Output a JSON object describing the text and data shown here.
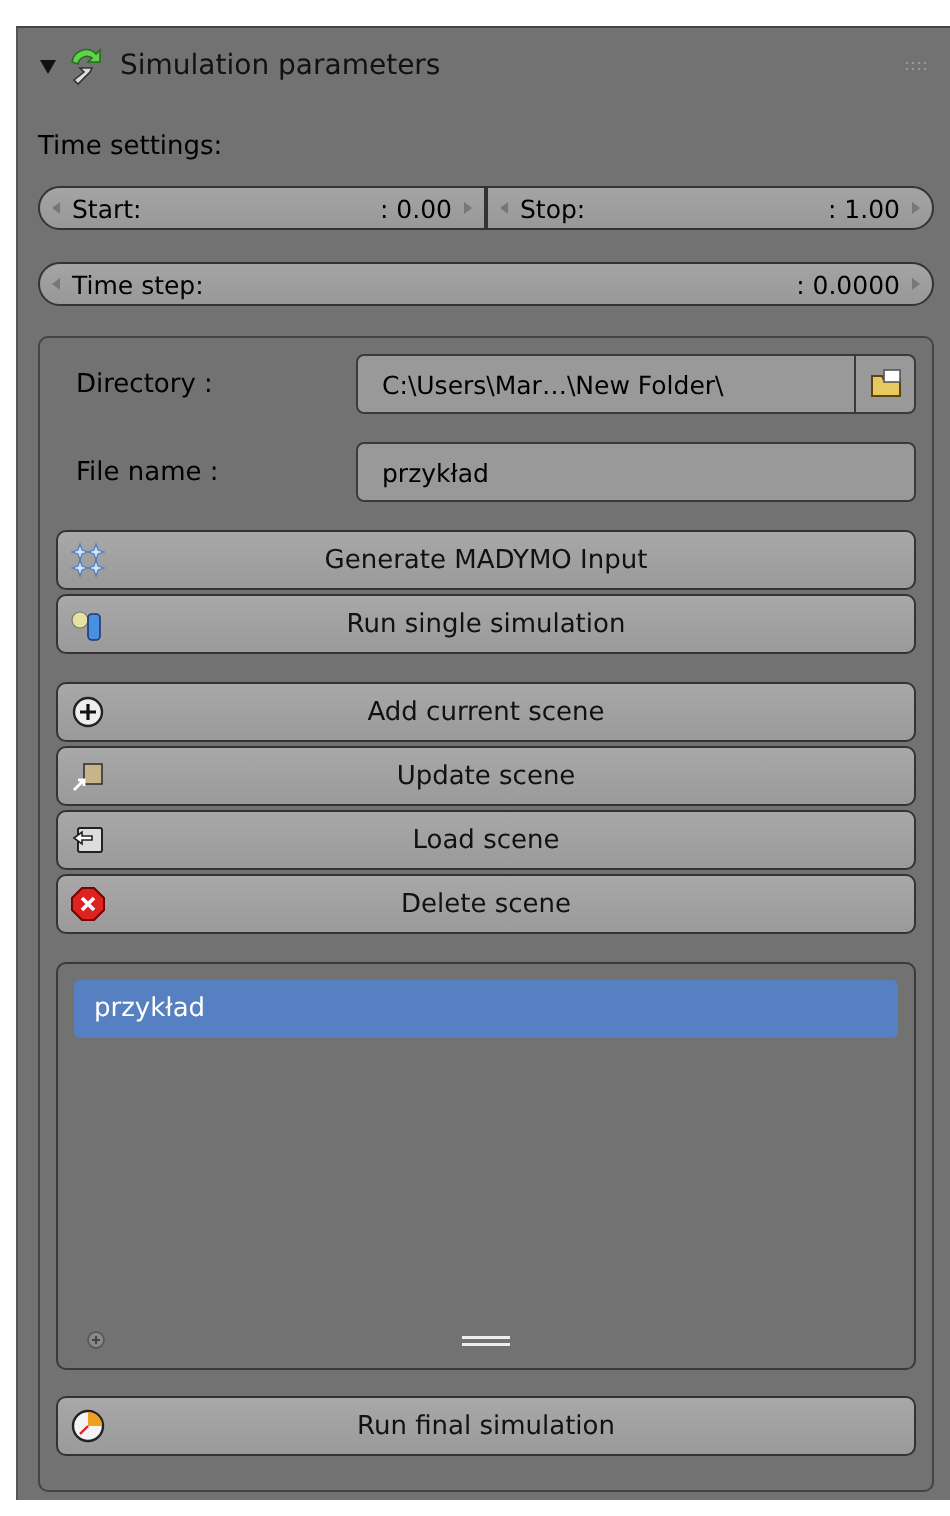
{
  "panel": {
    "title": "Simulation parameters",
    "expanded": true
  },
  "time_settings": {
    "label": "Time settings:",
    "start": {
      "label": "Start:",
      "value": ": 0.00"
    },
    "stop": {
      "label": "Stop:",
      "value": ": 1.00"
    },
    "time_step": {
      "label": "Time step:",
      "value": ": 0.0000"
    }
  },
  "directory": {
    "label": "Directory :",
    "value": "C:\\Users\\Mar…\\New Folder\\"
  },
  "file_name": {
    "label": "File name :",
    "value": "przykład"
  },
  "simulation_buttons": [
    {
      "label": "Generate MADYMO Input",
      "kind": "generate"
    },
    {
      "label": "Run single simulation",
      "kind": "run"
    }
  ],
  "scene_buttons": [
    {
      "label": "Add current scene",
      "kind": "add"
    },
    {
      "label": "Update scene",
      "kind": "update"
    },
    {
      "label": "Load scene",
      "kind": "load"
    },
    {
      "label": "Delete scene",
      "kind": "delete"
    }
  ],
  "scene_list": [
    {
      "label": "przykład",
      "selected": true
    }
  ],
  "final_button": {
    "label": "Run final simulation",
    "kind": "final"
  }
}
